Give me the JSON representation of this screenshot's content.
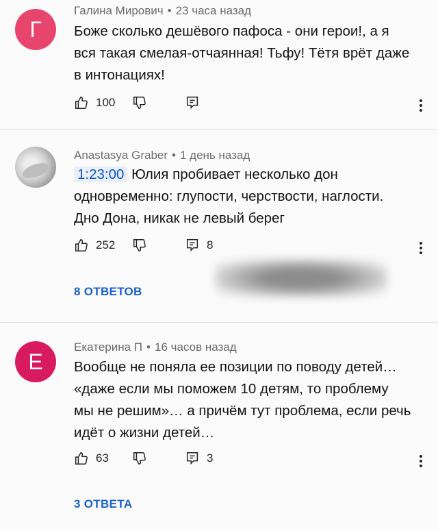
{
  "comments": [
    {
      "avatar_letter": "Г",
      "avatar_color": "#e8456e",
      "author": "Галина Мирович",
      "time": "23 часа назад",
      "lines": [
        "Боже сколько  дешёвого пафоса - они герои!, а я",
        "вся такая смелая-отчаянная!  Тьфу! Тётя врёт даже",
        "в интонациях!"
      ],
      "likes": "100",
      "reply_count": ""
    },
    {
      "avatar_letter": "",
      "avatar_color": "#bdbdbd",
      "author": "Anastasya Graber",
      "time": "1 день назад",
      "timestamp_link": "1:23:00",
      "lines": [
        " Юлия пробивает несколько дон",
        "одновременно: глупости, черствости, наглости.",
        "Дно Дона, никак не левый берег"
      ],
      "likes": "252",
      "reply_count": "8",
      "replies_label": "8 ОТВЕТОВ"
    },
    {
      "avatar_letter": "Е",
      "avatar_color": "#d81b60",
      "author": "Екатерина П",
      "time": "16 часов назад",
      "lines": [
        "Вообще не поняла ее позиции по поводу детей…",
        "«даже если мы поможем 10 детям, то проблему",
        "мы не решим»… а причём тут проблема, если речь",
        "идёт о жизни детей…"
      ],
      "likes": "63",
      "reply_count": "3",
      "replies_label": "3 ОТВЕТА"
    }
  ],
  "separator": "•",
  "colors": {
    "link": "#1a61c9",
    "meta": "#6b6b6b"
  }
}
